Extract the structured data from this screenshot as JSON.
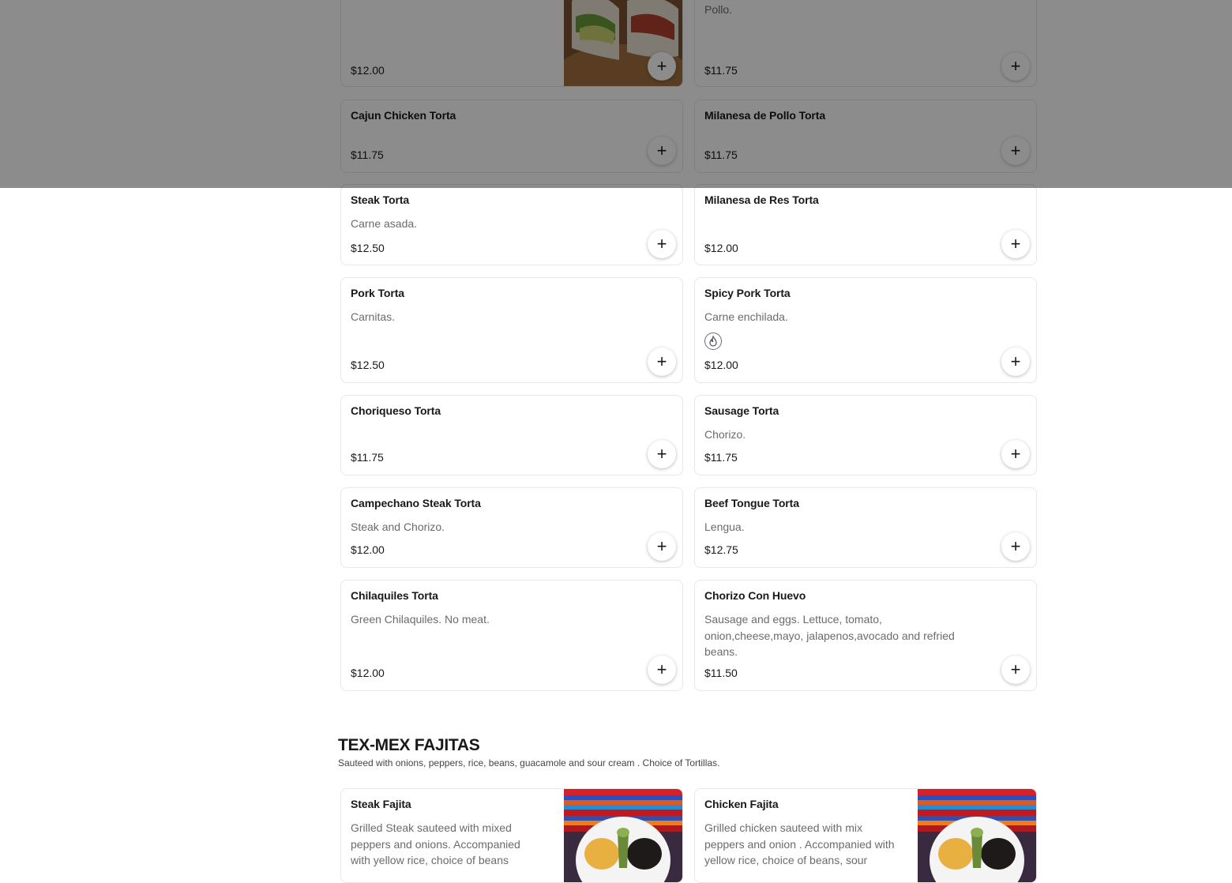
{
  "top_partial": {
    "left_price": "$12.00",
    "right_desc": "Pollo.",
    "right_price": "$11.75"
  },
  "items": [
    {
      "name": "Cajun Chicken Torta",
      "desc": "",
      "price": "$11.75"
    },
    {
      "name": "Milanesa de Pollo Torta",
      "desc": "",
      "price": "$11.75"
    },
    {
      "name": "Steak Torta",
      "desc": "Carne asada.",
      "price": "$12.50"
    },
    {
      "name": "Milanesa de Res Torta",
      "desc": "",
      "price": "$12.00"
    },
    {
      "name": "Pork Torta",
      "desc": "Carnitas.",
      "price": "$12.50"
    },
    {
      "name": "Spicy Pork Torta",
      "desc": "Carne enchilada.",
      "price": "$12.00",
      "icon": "spicy-flame-icon"
    },
    {
      "name": "Choriqueso Torta",
      "desc": "",
      "price": "$11.75"
    },
    {
      "name": "Sausage Torta",
      "desc": "Chorizo.",
      "price": "$11.75"
    },
    {
      "name": "Campechano Steak Torta",
      "desc": "Steak and Chorizo.",
      "price": "$12.00"
    },
    {
      "name": "Beef Tongue Torta",
      "desc": "Lengua.",
      "price": "$12.75"
    },
    {
      "name": "Chilaquiles Torta",
      "desc": "Green Chilaquiles. No meat.",
      "price": "$12.00"
    },
    {
      "name": "Chorizo Con Huevo",
      "desc": "Sausage and eggs. Lettuce, tomato, onion,cheese,mayo, jalapenos,avocado and refried beans.",
      "price": "$11.50"
    }
  ],
  "section": {
    "title": "TEX-MEX FAJITAS",
    "subtitle": "Sauteed with onions, peppers, rice, beans, guacamole and sour cream . Choice of Tortillas."
  },
  "fajitas": [
    {
      "name": "Steak Fajita",
      "desc": "Grilled Steak sauteed with mixed peppers and onions. Accompanied with yellow rice, choice of beans"
    },
    {
      "name": "Chicken Fajita",
      "desc": "Grilled chicken sauteed with mix peppers and onion . Accompanied with yellow rice, choice of beans, sour"
    }
  ],
  "add_glyph": "+",
  "colors": {
    "text": "#191919",
    "muted": "#6b6b6b",
    "border": "#e7e7e7",
    "overlay": "rgba(0,0,0,0.45)"
  }
}
